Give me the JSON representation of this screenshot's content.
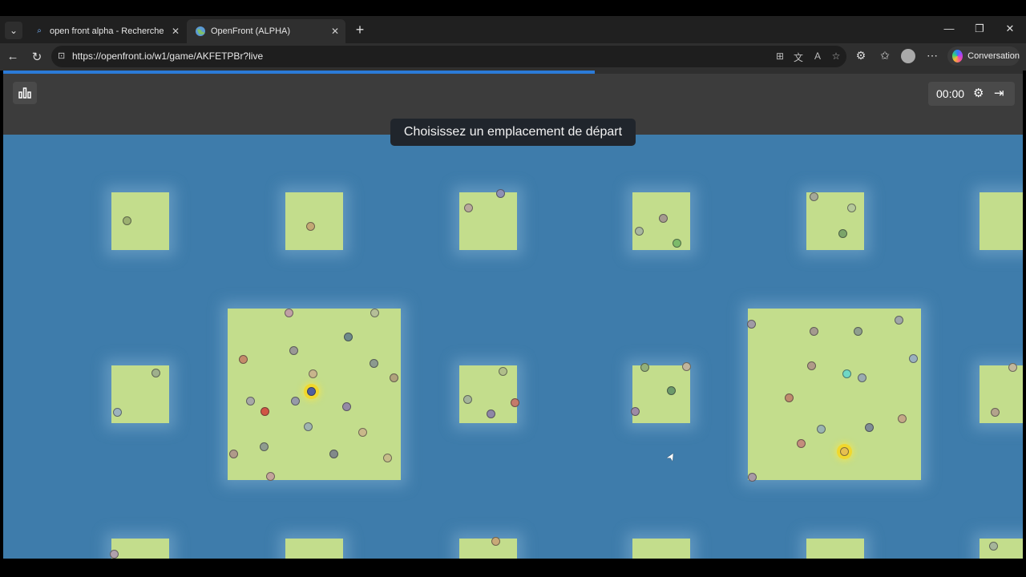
{
  "browser": {
    "tabs": [
      {
        "title": "open front alpha - Recherche",
        "icon": "search-icon",
        "active": false
      },
      {
        "title": "OpenFront (ALPHA)",
        "icon": "globe-icon",
        "active": true
      }
    ],
    "url": "https://openfront.io/w1/game/AKFETPBr?live",
    "conversation_label": "Conversation",
    "loading_progress": 0.58
  },
  "hud": {
    "timer": "00:00",
    "leaderboard_icon": "bar-chart-icon",
    "settings_icon": "gear-icon",
    "exit_icon": "exit-icon"
  },
  "banner": {
    "text": "Choisissez un emplacement de départ"
  },
  "colors": {
    "ocean": "#3e7cab",
    "land": "#c3dd8c",
    "hud": "#3c3c3c",
    "accent_progress": "#2b7bd8"
  }
}
